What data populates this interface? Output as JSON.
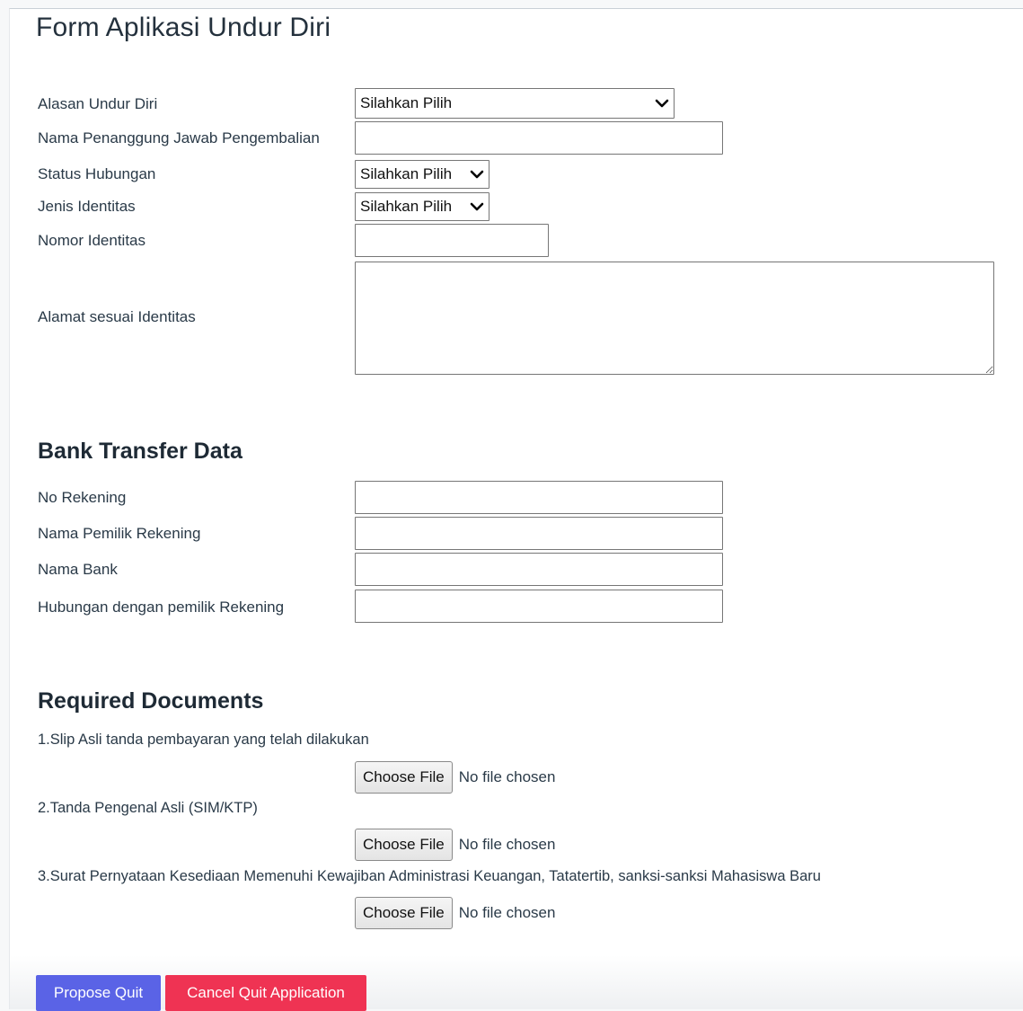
{
  "page": {
    "title": "Form Aplikasi Undur Diri"
  },
  "form": {
    "reason_label": "Alasan Undur Diri",
    "reason_value": "Silahkan Pilih",
    "responsible_name_label": "Nama Penanggung Jawab Pengembalian",
    "responsible_name_value": "",
    "relation_status_label": "Status Hubungan",
    "relation_status_value": "Silahkan Pilih",
    "id_type_label": "Jenis Identitas",
    "id_type_value": "Silahkan Pilih",
    "id_number_label": "Nomor Identitas",
    "id_number_value": "",
    "address_label": "Alamat sesuai Identitas",
    "address_value": ""
  },
  "bank": {
    "title": "Bank Transfer Data",
    "account_number_label": "No Rekening",
    "account_number_value": "",
    "account_owner_label": "Nama Pemilik Rekening",
    "account_owner_value": "",
    "bank_name_label": "Nama Bank",
    "bank_name_value": "",
    "relation_label": "Hubungan dengan pemilik Rekening",
    "relation_value": ""
  },
  "documents": {
    "title": "Required Documents",
    "items": [
      {
        "label": "1.Slip Asli tanda pembayaran yang telah dilakukan",
        "button": "Choose File",
        "status": "No file chosen"
      },
      {
        "label": "2.Tanda Pengenal Asli (SIM/KTP)",
        "button": "Choose File",
        "status": "No file chosen"
      },
      {
        "label": "3.Surat Pernyataan Kesediaan Memenuhi Kewajiban Administrasi Keuangan, Tatatertib, sanksi-sanksi Mahasiswa Baru",
        "button": "Choose File",
        "status": "No file chosen"
      }
    ]
  },
  "actions": {
    "propose_label": "Propose Quit",
    "cancel_label": "Cancel Quit Application"
  },
  "colors": {
    "propose_bg": "#5a63e6",
    "cancel_bg": "#ef3353"
  },
  "icons": {
    "select_arrow": "chevron-down-icon"
  }
}
